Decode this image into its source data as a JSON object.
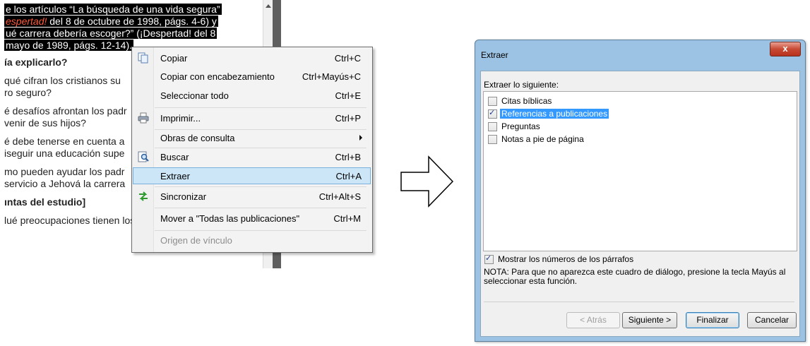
{
  "document": {
    "lines": [
      "e los artículos “La búsqueda de una vida segura”",
      "espertad! del 8 de octubre de 1998, págs. 4-6) y",
      "ué carrera debería escoger?” (¡Despertad! del 8",
      "mayo de 1989, págs. 12-14).",
      "ía explicarlo?",
      "qué cifran los cristianos su",
      "ro seguro?",
      "é desafíos afrontan los padr",
      "venir de sus hijos?",
      "é debe tenerse en cuenta a",
      "iseguir una educación supe",
      "mo pueden ayudar los padr",
      "servicio a Jehová la carrera",
      "ıntas del estudio]",
      "lué preocupaciones tienen los padres?"
    ]
  },
  "context_menu": {
    "items": [
      {
        "label": "Copiar",
        "shortcut": "Ctrl+C",
        "icon": "copy-icon"
      },
      {
        "label": "Copiar con encabezamiento",
        "shortcut": "Ctrl+Mayús+C"
      },
      {
        "label": "Seleccionar todo",
        "shortcut": "Ctrl+E"
      },
      {
        "label": "Imprimir...",
        "shortcut": "Ctrl+P",
        "icon": "printer-icon"
      },
      {
        "label": "Obras de consulta",
        "shortcut": ""
      },
      {
        "label": "Buscar",
        "shortcut": "Ctrl+B",
        "icon": "search-icon"
      },
      {
        "label": "Extraer",
        "shortcut": "Ctrl+A",
        "selected": true
      },
      {
        "label": "Sincronizar",
        "shortcut": "Ctrl+Alt+S",
        "icon": "sync-arrows-icon"
      },
      {
        "label": "Mover a \"Todas las publicaciones\"",
        "shortcut": "Ctrl+M"
      },
      {
        "label": "Origen de vínculo",
        "shortcut": "",
        "disabled": true
      }
    ]
  },
  "dialog": {
    "title": "Extraer",
    "close_label": "x",
    "header": "Extraer lo siguiente:",
    "options": [
      {
        "label": "Citas bíblicas",
        "checked": false
      },
      {
        "label": "Referencias a publicaciones",
        "checked": true,
        "selected": true
      },
      {
        "label": "Preguntas",
        "checked": false
      },
      {
        "label": "Notas a pie de página",
        "checked": false
      }
    ],
    "show_numbers": {
      "label": "Mostrar los números de los párrafos",
      "checked": true
    },
    "note": "NOTA: Para que no aparezca este cuadro de diálogo, presione la tecla Mayús al seleccionar esta función.",
    "buttons": {
      "back": "< Atrás",
      "next": "Siguiente >",
      "finish": "Finalizar",
      "cancel": "Cancelar"
    }
  },
  "colors": {
    "selection_highlight": "#3399ff",
    "menu_selected": "#cde6f7",
    "dialog_frame": "#9cc3e3",
    "red_italic_text": "#ff5a3c"
  }
}
